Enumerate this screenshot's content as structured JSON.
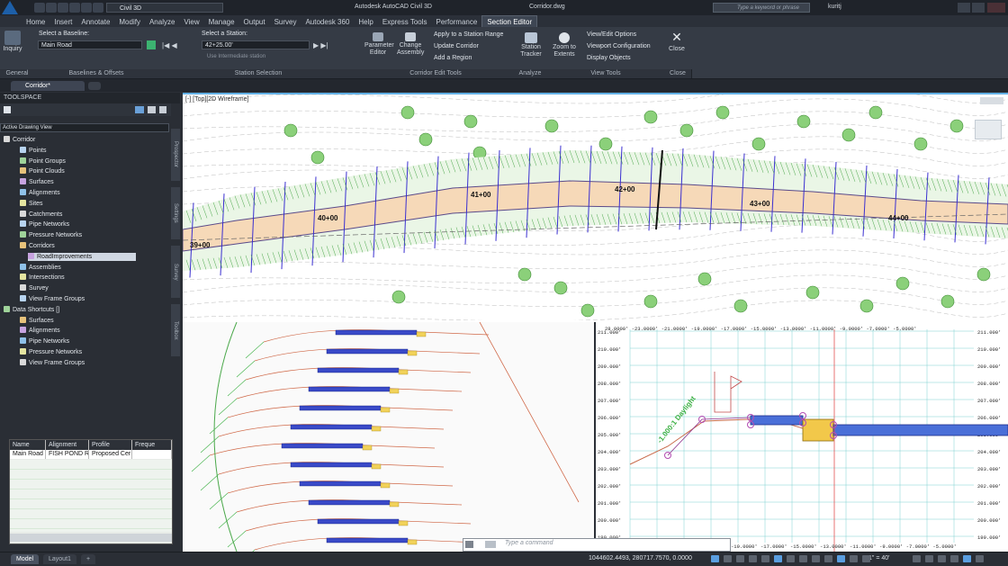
{
  "titlebar": {
    "workspace": "Civil 3D",
    "app_title": "Autodesk AutoCAD Civil 3D",
    "file_name": "Corridor.dwg",
    "search_placeholder": "Type a keyword or phrase",
    "user": "kuritj"
  },
  "menu_tabs": [
    "Home",
    "Insert",
    "Annotate",
    "Modify",
    "Analyze",
    "View",
    "Manage",
    "Output",
    "Survey",
    "Autodesk 360",
    "Help",
    "Express Tools",
    "Performance",
    "Section Editor"
  ],
  "active_tab": "Section Editor",
  "ribbon": {
    "inquiry_label": "Inquiry",
    "baseline_label": "Select a Baseline:",
    "baseline_value": "Main Road",
    "station_label": "Select a Station:",
    "station_value": "42+25.00'",
    "intermediate_label": "Use Intermediate station",
    "parameter_editor": "Parameter Editor",
    "change_assembly": "Change Assembly",
    "apply_range": "Apply to a Station Range",
    "update_corridor": "Update Corridor",
    "add_region": "Add a Region",
    "station_tracker": "Station Tracker",
    "zoom_extents": "Zoom to Extents",
    "view_edit_options": "View/Edit Options",
    "viewport_config": "Viewport Configuration",
    "display_objects": "Display Objects",
    "close": "Close",
    "panels": [
      "General",
      "Baselines & Offsets",
      "Station Selection",
      "Corridor Edit Tools",
      "Analyze",
      "View Tools",
      "Close"
    ]
  },
  "doc_tab": "Corridor*",
  "toolspace": {
    "title": "TOOLSPACE",
    "view_select": "Active Drawing View",
    "tree": [
      {
        "label": "Corridor",
        "depth": 0
      },
      {
        "label": "Points",
        "depth": 2
      },
      {
        "label": "Point Groups",
        "depth": 2
      },
      {
        "label": "Point Clouds",
        "depth": 2
      },
      {
        "label": "Surfaces",
        "depth": 2
      },
      {
        "label": "Alignments",
        "depth": 2
      },
      {
        "label": "Sites",
        "depth": 2
      },
      {
        "label": "Catchments",
        "depth": 2
      },
      {
        "label": "Pipe Networks",
        "depth": 2
      },
      {
        "label": "Pressure Networks",
        "depth": 2
      },
      {
        "label": "Corridors",
        "depth": 2
      },
      {
        "label": "RoadImprovements",
        "depth": 3
      },
      {
        "label": "Assemblies",
        "depth": 2
      },
      {
        "label": "Intersections",
        "depth": 2
      },
      {
        "label": "Survey",
        "depth": 2
      },
      {
        "label": "View Frame Groups",
        "depth": 2
      },
      {
        "label": "Data Shortcuts []",
        "depth": 0
      },
      {
        "label": "Surfaces",
        "depth": 2
      },
      {
        "label": "Alignments",
        "depth": 2
      },
      {
        "label": "Pipe Networks",
        "depth": 2
      },
      {
        "label": "Pressure Networks",
        "depth": 2
      },
      {
        "label": "View Frame Groups",
        "depth": 2
      }
    ],
    "side_tabs": [
      "Prospector",
      "Settings",
      "Survey",
      "Toolbox"
    ],
    "grid_headers": [
      "Name",
      "Alignment",
      "Profile",
      "Freque"
    ],
    "grid_row": [
      "Main Road",
      "FISH POND R",
      "Proposed Cer",
      ""
    ]
  },
  "viewport_top": {
    "label": "[-] [Top][2D Wireframe]",
    "stations": [
      "39+00",
      "40+00",
      "41+00",
      "42+00",
      "43+00",
      "44+00"
    ]
  },
  "section_view": {
    "elevations": [
      "211.000'",
      "210.000'",
      "209.000'",
      "208.000'",
      "207.000'",
      "206.000'",
      "205.000'",
      "204.000'",
      "203.000'",
      "202.000'",
      "201.000'",
      "200.000'",
      "199.000'"
    ],
    "offsets_top": "28.0000' -23.0000' -21.0000' -19.0000' -17.0000' -15.0000' -13.0000' -11.0000' -9.0000' -7.0000' -5.0000'",
    "offsets_bottom": "-19.0000' -17.0000' -15.0000' -13.0000' -11.0000' -9.0000' -7.0000' -5.0000'",
    "daylight_label": "-1.000:1 Daylight"
  },
  "command_line_placeholder": "Type a command",
  "status": {
    "model_tab": "Model",
    "layout_tab": "Layout1",
    "coordinates": "1044602.4493, 280717.7570, 0.0000",
    "scale": "1\" = 40'"
  }
}
